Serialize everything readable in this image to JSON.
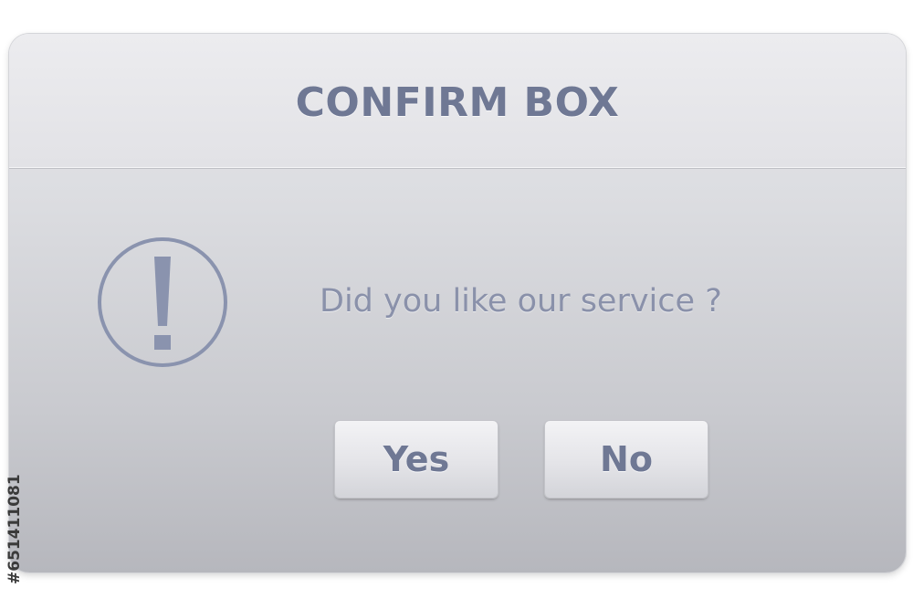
{
  "dialog": {
    "title": "CONFIRM BOX",
    "message": "Did you like our service ?",
    "icon": "exclamation-circle-icon",
    "buttons": {
      "yes_label": "Yes",
      "no_label": "No"
    }
  },
  "watermark": {
    "stock_id": "#651411081"
  },
  "colors": {
    "text_accent": "#6f7894",
    "message_text": "#8a91aa",
    "icon_stroke": "#8a93ae"
  }
}
